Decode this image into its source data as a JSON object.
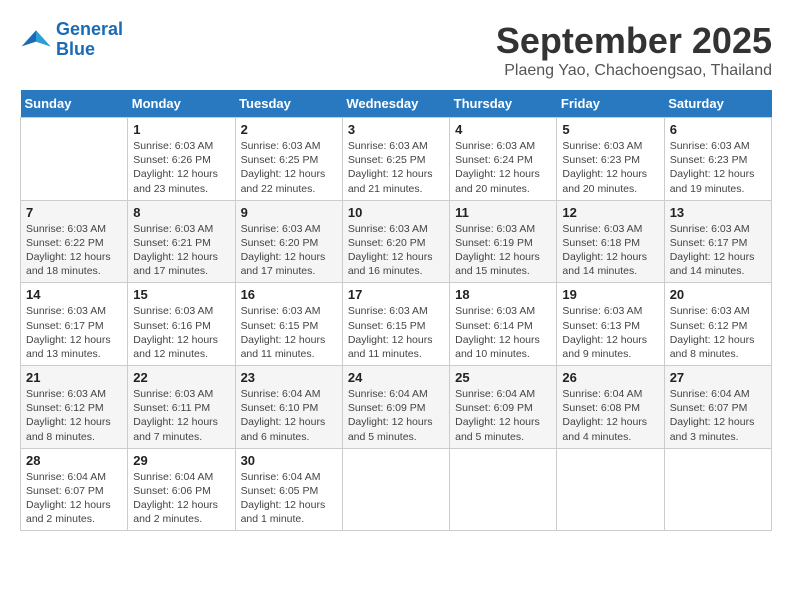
{
  "header": {
    "logo_line1": "General",
    "logo_line2": "Blue",
    "month": "September 2025",
    "location": "Plaeng Yao, Chachoengsao, Thailand"
  },
  "days_of_week": [
    "Sunday",
    "Monday",
    "Tuesday",
    "Wednesday",
    "Thursday",
    "Friday",
    "Saturday"
  ],
  "weeks": [
    [
      {
        "day": "",
        "sunrise": "",
        "sunset": "",
        "daylight": ""
      },
      {
        "day": "1",
        "sunrise": "Sunrise: 6:03 AM",
        "sunset": "Sunset: 6:26 PM",
        "daylight": "Daylight: 12 hours and 23 minutes."
      },
      {
        "day": "2",
        "sunrise": "Sunrise: 6:03 AM",
        "sunset": "Sunset: 6:25 PM",
        "daylight": "Daylight: 12 hours and 22 minutes."
      },
      {
        "day": "3",
        "sunrise": "Sunrise: 6:03 AM",
        "sunset": "Sunset: 6:25 PM",
        "daylight": "Daylight: 12 hours and 21 minutes."
      },
      {
        "day": "4",
        "sunrise": "Sunrise: 6:03 AM",
        "sunset": "Sunset: 6:24 PM",
        "daylight": "Daylight: 12 hours and 20 minutes."
      },
      {
        "day": "5",
        "sunrise": "Sunrise: 6:03 AM",
        "sunset": "Sunset: 6:23 PM",
        "daylight": "Daylight: 12 hours and 20 minutes."
      },
      {
        "day": "6",
        "sunrise": "Sunrise: 6:03 AM",
        "sunset": "Sunset: 6:23 PM",
        "daylight": "Daylight: 12 hours and 19 minutes."
      }
    ],
    [
      {
        "day": "7",
        "sunrise": "Sunrise: 6:03 AM",
        "sunset": "Sunset: 6:22 PM",
        "daylight": "Daylight: 12 hours and 18 minutes."
      },
      {
        "day": "8",
        "sunrise": "Sunrise: 6:03 AM",
        "sunset": "Sunset: 6:21 PM",
        "daylight": "Daylight: 12 hours and 17 minutes."
      },
      {
        "day": "9",
        "sunrise": "Sunrise: 6:03 AM",
        "sunset": "Sunset: 6:20 PM",
        "daylight": "Daylight: 12 hours and 17 minutes."
      },
      {
        "day": "10",
        "sunrise": "Sunrise: 6:03 AM",
        "sunset": "Sunset: 6:20 PM",
        "daylight": "Daylight: 12 hours and 16 minutes."
      },
      {
        "day": "11",
        "sunrise": "Sunrise: 6:03 AM",
        "sunset": "Sunset: 6:19 PM",
        "daylight": "Daylight: 12 hours and 15 minutes."
      },
      {
        "day": "12",
        "sunrise": "Sunrise: 6:03 AM",
        "sunset": "Sunset: 6:18 PM",
        "daylight": "Daylight: 12 hours and 14 minutes."
      },
      {
        "day": "13",
        "sunrise": "Sunrise: 6:03 AM",
        "sunset": "Sunset: 6:17 PM",
        "daylight": "Daylight: 12 hours and 14 minutes."
      }
    ],
    [
      {
        "day": "14",
        "sunrise": "Sunrise: 6:03 AM",
        "sunset": "Sunset: 6:17 PM",
        "daylight": "Daylight: 12 hours and 13 minutes."
      },
      {
        "day": "15",
        "sunrise": "Sunrise: 6:03 AM",
        "sunset": "Sunset: 6:16 PM",
        "daylight": "Daylight: 12 hours and 12 minutes."
      },
      {
        "day": "16",
        "sunrise": "Sunrise: 6:03 AM",
        "sunset": "Sunset: 6:15 PM",
        "daylight": "Daylight: 12 hours and 11 minutes."
      },
      {
        "day": "17",
        "sunrise": "Sunrise: 6:03 AM",
        "sunset": "Sunset: 6:15 PM",
        "daylight": "Daylight: 12 hours and 11 minutes."
      },
      {
        "day": "18",
        "sunrise": "Sunrise: 6:03 AM",
        "sunset": "Sunset: 6:14 PM",
        "daylight": "Daylight: 12 hours and 10 minutes."
      },
      {
        "day": "19",
        "sunrise": "Sunrise: 6:03 AM",
        "sunset": "Sunset: 6:13 PM",
        "daylight": "Daylight: 12 hours and 9 minutes."
      },
      {
        "day": "20",
        "sunrise": "Sunrise: 6:03 AM",
        "sunset": "Sunset: 6:12 PM",
        "daylight": "Daylight: 12 hours and 8 minutes."
      }
    ],
    [
      {
        "day": "21",
        "sunrise": "Sunrise: 6:03 AM",
        "sunset": "Sunset: 6:12 PM",
        "daylight": "Daylight: 12 hours and 8 minutes."
      },
      {
        "day": "22",
        "sunrise": "Sunrise: 6:03 AM",
        "sunset": "Sunset: 6:11 PM",
        "daylight": "Daylight: 12 hours and 7 minutes."
      },
      {
        "day": "23",
        "sunrise": "Sunrise: 6:04 AM",
        "sunset": "Sunset: 6:10 PM",
        "daylight": "Daylight: 12 hours and 6 minutes."
      },
      {
        "day": "24",
        "sunrise": "Sunrise: 6:04 AM",
        "sunset": "Sunset: 6:09 PM",
        "daylight": "Daylight: 12 hours and 5 minutes."
      },
      {
        "day": "25",
        "sunrise": "Sunrise: 6:04 AM",
        "sunset": "Sunset: 6:09 PM",
        "daylight": "Daylight: 12 hours and 5 minutes."
      },
      {
        "day": "26",
        "sunrise": "Sunrise: 6:04 AM",
        "sunset": "Sunset: 6:08 PM",
        "daylight": "Daylight: 12 hours and 4 minutes."
      },
      {
        "day": "27",
        "sunrise": "Sunrise: 6:04 AM",
        "sunset": "Sunset: 6:07 PM",
        "daylight": "Daylight: 12 hours and 3 minutes."
      }
    ],
    [
      {
        "day": "28",
        "sunrise": "Sunrise: 6:04 AM",
        "sunset": "Sunset: 6:07 PM",
        "daylight": "Daylight: 12 hours and 2 minutes."
      },
      {
        "day": "29",
        "sunrise": "Sunrise: 6:04 AM",
        "sunset": "Sunset: 6:06 PM",
        "daylight": "Daylight: 12 hours and 2 minutes."
      },
      {
        "day": "30",
        "sunrise": "Sunrise: 6:04 AM",
        "sunset": "Sunset: 6:05 PM",
        "daylight": "Daylight: 12 hours and 1 minute."
      },
      {
        "day": "",
        "sunrise": "",
        "sunset": "",
        "daylight": ""
      },
      {
        "day": "",
        "sunrise": "",
        "sunset": "",
        "daylight": ""
      },
      {
        "day": "",
        "sunrise": "",
        "sunset": "",
        "daylight": ""
      },
      {
        "day": "",
        "sunrise": "",
        "sunset": "",
        "daylight": ""
      }
    ]
  ]
}
